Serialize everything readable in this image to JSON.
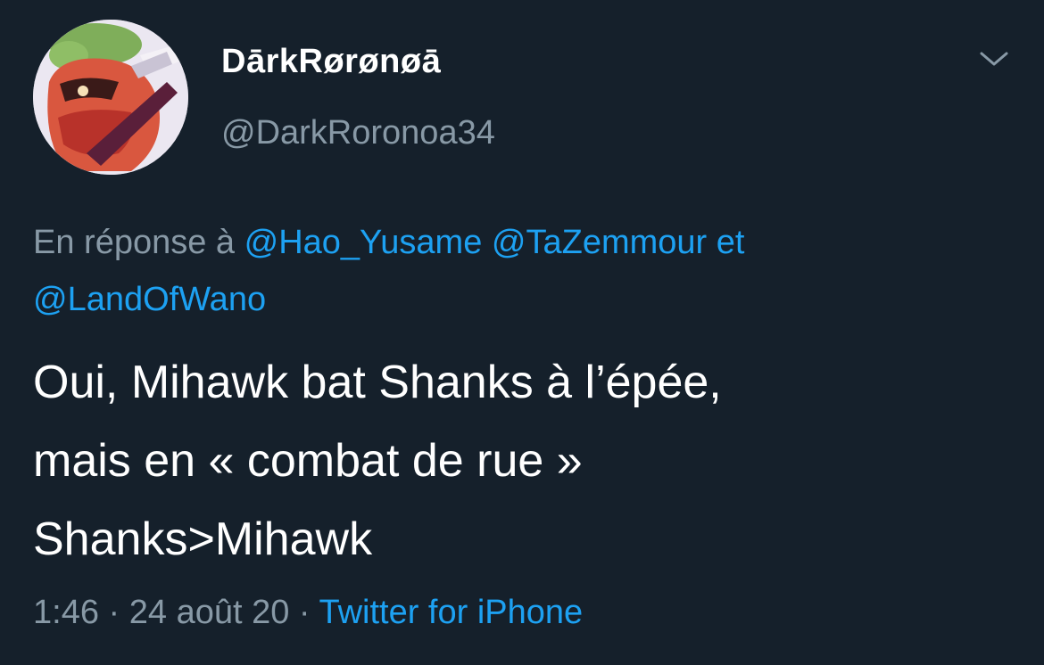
{
  "author": {
    "display_name": "DārkRørønøā",
    "handle": "@DarkRoronoa34"
  },
  "icons": {
    "avatar": "profile-avatar",
    "menu": "chevron-down-icon"
  },
  "reply_context": {
    "prefix": "En réponse à",
    "mention_1": "@Hao_Yusame",
    "mention_2": "@TaZemmour",
    "conjunction": "et",
    "mention_3": "@LandOfWano"
  },
  "tweet": {
    "line_1": "Oui, Mihawk bat Shanks à l’épée,",
    "line_2": "mais en « combat de rue »",
    "line_3": "Shanks>Mihawk"
  },
  "meta": {
    "time": "1:46",
    "separator": "·",
    "date": "24 août 20",
    "source": "Twitter for iPhone"
  },
  "colors": {
    "background": "#15202b",
    "text_primary": "#ffffff",
    "text_secondary": "#8899a6",
    "link": "#1da1f2"
  }
}
